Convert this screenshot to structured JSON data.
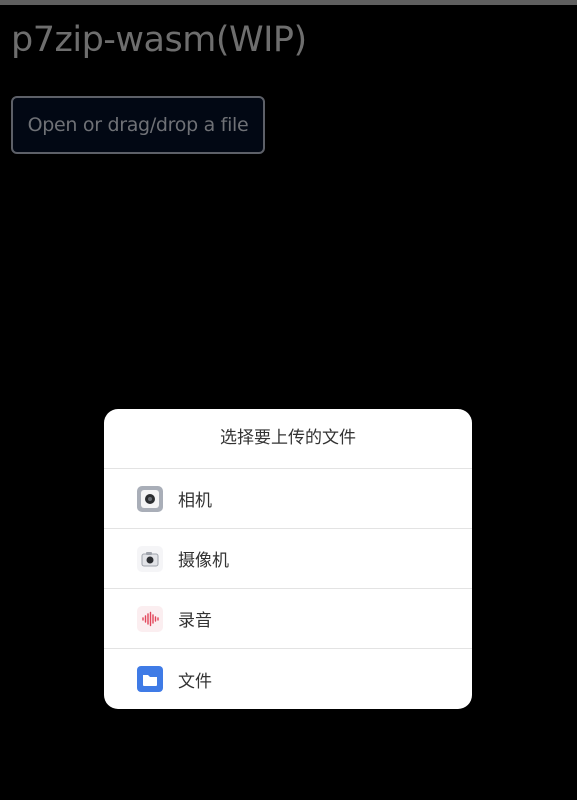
{
  "app": {
    "title": "p7zip-wasm(WIP)"
  },
  "open_button": {
    "label": "Open or drag/drop a file"
  },
  "file_chooser": {
    "title": "选择要上传的文件",
    "options": [
      {
        "label": "相机",
        "icon": "camera-icon",
        "color": "#a9aeb8"
      },
      {
        "label": "摄像机",
        "icon": "video-camera-icon",
        "color": "#555a63"
      },
      {
        "label": "录音",
        "icon": "audio-recorder-icon",
        "color": "#e2455a"
      },
      {
        "label": "文件",
        "icon": "folder-icon",
        "color": "#3f7be6"
      }
    ]
  }
}
